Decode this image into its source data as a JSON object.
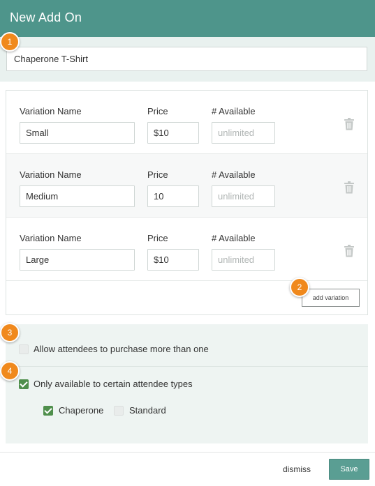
{
  "header": {
    "title": "New Add On"
  },
  "addon": {
    "name_value": "Chaperone T-Shirt"
  },
  "variations": {
    "col_name": "Variation Name",
    "col_price": "Price",
    "col_available": "# Available",
    "available_placeholder": "unlimited",
    "rows": [
      {
        "name": "Small",
        "price": "$10"
      },
      {
        "name": "Medium",
        "price": "10"
      },
      {
        "name": "Large",
        "price": "$10"
      }
    ],
    "add_label": "add variation"
  },
  "options": {
    "multi_purchase_label": "Allow attendees to purchase more than one",
    "multi_purchase_checked": false,
    "restrict_label": "Only available to certain attendee types",
    "restrict_checked": true,
    "types": [
      {
        "label": "Chaperone",
        "checked": true
      },
      {
        "label": "Standard",
        "checked": false
      }
    ]
  },
  "footer": {
    "dismiss_label": "dismiss",
    "save_label": "Save"
  },
  "callouts": [
    "1",
    "2",
    "3",
    "4"
  ],
  "colors": {
    "header": "#4e958b",
    "accent": "#f0891d",
    "check": "#4f8f4c"
  },
  "icons": {
    "delete": "trash-icon",
    "checked": "checkmark-icon"
  }
}
